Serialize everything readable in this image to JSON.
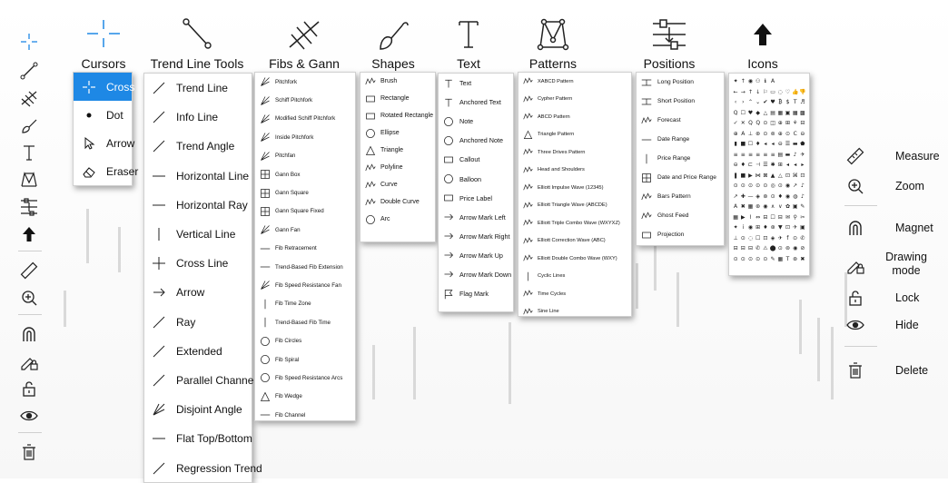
{
  "accent_color": "#1e88e5",
  "headers": {
    "cursors": "Cursors",
    "trend": "Trend Line Tools",
    "fibs": "Fibs & Gann",
    "shapes": "Shapes",
    "text": "Text",
    "patterns": "Patterns",
    "positions": "Positions",
    "icons": "Icons"
  },
  "toolbar": {
    "items": [
      "cursor-cross-icon",
      "trend-line-icon",
      "fib-icon",
      "brush-icon",
      "text-icon",
      "pattern-icon",
      "positions-icon",
      "arrow-up-icon",
      "measure-icon",
      "zoom-icon",
      "magnet-icon",
      "drawing-mode-lock-icon",
      "unlock-icon",
      "eye-icon",
      "trash-icon"
    ]
  },
  "cursors_menu": [
    {
      "label": "Cross",
      "icon": "cross-icon",
      "selected": true
    },
    {
      "label": "Dot",
      "icon": "dot-icon",
      "selected": false
    },
    {
      "label": "Arrow",
      "icon": "arrow-pointer-icon",
      "selected": false
    },
    {
      "label": "Eraser",
      "icon": "eraser-icon",
      "selected": false
    }
  ],
  "trend_menu": [
    {
      "label": "Trend Line",
      "icon": "trend-line-icon"
    },
    {
      "label": "Info Line",
      "icon": "info-line-icon"
    },
    {
      "label": "Trend Angle",
      "icon": "trend-angle-icon"
    },
    {
      "label": "Horizontal Line",
      "icon": "horizontal-line-icon"
    },
    {
      "label": "Horizontal Ray",
      "icon": "horizontal-ray-icon"
    },
    {
      "label": "Vertical Line",
      "icon": "vertical-line-icon"
    },
    {
      "label": "Cross Line",
      "icon": "cross-line-icon"
    },
    {
      "label": "Arrow",
      "icon": "arrow-line-icon"
    },
    {
      "label": "Ray",
      "icon": "ray-icon"
    },
    {
      "label": "Extended",
      "icon": "extended-line-icon"
    },
    {
      "label": "Parallel Channel",
      "icon": "parallel-channel-icon"
    },
    {
      "label": "Disjoint Angle",
      "icon": "disjoint-angle-icon"
    },
    {
      "label": "Flat Top/Bottom",
      "icon": "flat-top-bottom-icon"
    },
    {
      "label": "Regression Trend",
      "icon": "regression-trend-icon"
    }
  ],
  "fibs_menu": [
    {
      "label": "Pitchfork"
    },
    {
      "label": "Schiff Pitchfork"
    },
    {
      "label": "Modified Schiff Pitchfork"
    },
    {
      "label": "Inside Pitchfork"
    },
    {
      "label": "Pitchfan"
    },
    {
      "label": "Gann Box"
    },
    {
      "label": "Gann Square"
    },
    {
      "label": "Gann Square Fixed"
    },
    {
      "label": "Gann Fan"
    },
    {
      "label": "Fib Retracement"
    },
    {
      "label": "Trend-Based Fib Extension"
    },
    {
      "label": "Fib Speed Resistance Fan"
    },
    {
      "label": "Fib Time Zone"
    },
    {
      "label": "Trend-Based Fib Time"
    },
    {
      "label": "Fib Circles"
    },
    {
      "label": "Fib Spiral"
    },
    {
      "label": "Fib Speed Resistance Arcs"
    },
    {
      "label": "Fib Wedge"
    },
    {
      "label": "Fib Channel"
    }
  ],
  "shapes_menu": [
    {
      "label": "Brush"
    },
    {
      "label": "Rectangle"
    },
    {
      "label": "Rotated Rectangle"
    },
    {
      "label": "Ellipse"
    },
    {
      "label": "Triangle"
    },
    {
      "label": "Polyline"
    },
    {
      "label": "Curve"
    },
    {
      "label": "Double Curve"
    },
    {
      "label": "Arc"
    }
  ],
  "text_menu": [
    {
      "label": "Text"
    },
    {
      "label": "Anchored Text"
    },
    {
      "label": "Note"
    },
    {
      "label": "Anchored Note"
    },
    {
      "label": "Callout"
    },
    {
      "label": "Balloon"
    },
    {
      "label": "Price Label"
    },
    {
      "label": "Arrow Mark Left"
    },
    {
      "label": "Arrow Mark Right"
    },
    {
      "label": "Arrow Mark Up"
    },
    {
      "label": "Arrow Mark Down"
    },
    {
      "label": "Flag Mark"
    }
  ],
  "patterns_menu": [
    {
      "label": "XABCD Pattern"
    },
    {
      "label": "Cypher Pattern"
    },
    {
      "label": "ABCD Pattern"
    },
    {
      "label": "Triangle Pattern"
    },
    {
      "label": "Three Drives Pattern"
    },
    {
      "label": "Head and Shoulders"
    },
    {
      "label": "Elliott Impulse Wave (12345)"
    },
    {
      "label": "Elliott Triangle Wave (ABCDE)"
    },
    {
      "label": "Elliott Triple Combo Wave (WXYXZ)"
    },
    {
      "label": "Elliott Correction Wave (ABC)"
    },
    {
      "label": "Elliott Double Combo Wave (WXY)"
    },
    {
      "label": "Cyclic Lines"
    },
    {
      "label": "Time Cycles"
    },
    {
      "label": "Sine Line"
    }
  ],
  "positions_menu": [
    {
      "label": "Long Position"
    },
    {
      "label": "Short Position"
    },
    {
      "label": "Forecast"
    },
    {
      "label": "Date Range"
    },
    {
      "label": "Price Range"
    },
    {
      "label": "Date and Price Range"
    },
    {
      "label": "Bars Pattern"
    },
    {
      "label": "Ghost Feed"
    },
    {
      "label": "Projection"
    }
  ],
  "icons_grid": [
    "✦",
    "↑",
    "◉",
    "⚇",
    "ℹ",
    "A",
    "",
    "",
    "",
    "",
    "←",
    "→",
    "↑",
    "↓",
    "⚐",
    "▭",
    "◌",
    "♡",
    "👍",
    "👎",
    "‹",
    "›",
    "⌃",
    "⌄",
    "✔",
    "♥",
    "₿",
    "$",
    "T",
    "♬",
    "Q",
    "☐",
    "♥",
    "◆",
    "△",
    "▤",
    "▦",
    "▣",
    "▦",
    "▩",
    "✓",
    "✕",
    "Q",
    "Q",
    "⊙",
    "◫",
    "⊕",
    "⊞",
    "⚘",
    "⊟",
    "⊕",
    "A",
    "⊥",
    "⊛",
    "⊙",
    "⊚",
    "⊕",
    "⊙",
    "C",
    "⊖",
    "▮",
    "■",
    "☐",
    "♦",
    "◂",
    "◂",
    "⊖",
    "☰",
    "▬",
    "⬟",
    "≡",
    "≡",
    "≡",
    "≡",
    "≡",
    "≡",
    "▤",
    "▬",
    "♪",
    "✈",
    "⊖",
    "♦",
    "⊏",
    "⊣",
    "☰",
    "✱",
    "⊞",
    "◂",
    "◂",
    "▸",
    "❚",
    "■",
    "▶",
    "⋈",
    "⊠",
    "▲",
    "△",
    "⊡",
    "⌘",
    "⊡",
    "⊙",
    "⊙",
    "⊙",
    "⊙",
    "⊙",
    "◎",
    "⊙",
    "◉",
    "↗",
    "♪",
    "↗",
    "✚",
    "—",
    "◈",
    "⊛",
    "⊙",
    "♦",
    "◉",
    "◍",
    "♪",
    "A",
    "✖",
    "▦",
    "⊛",
    "◉",
    "∧",
    "∨",
    "✿",
    "▣",
    "✎",
    "▦",
    "▶",
    "⌇",
    "⇔",
    "⊟",
    "☐",
    "⊟",
    "✉",
    "⚲",
    "✂",
    "✦",
    "i",
    "◉",
    "⊞",
    "♦",
    "⊛",
    "▼",
    "⊡",
    "✈",
    "▣",
    "⊥",
    "⊙",
    "◌",
    "☐",
    "⊡",
    "◈",
    "✈",
    "f",
    "⊙",
    "✆",
    "⊟",
    "⊟",
    "⊟",
    "✆",
    "⚠",
    "⬤",
    "⊙",
    "⊚",
    "◉",
    "⊘",
    "⊙",
    "⊙",
    "⊙",
    "⊙",
    "⊙",
    "✎",
    "▦",
    "T",
    "⊛",
    "✖"
  ],
  "right_panel": [
    {
      "label": "Measure",
      "icon": "ruler-icon"
    },
    {
      "label": "Zoom",
      "icon": "zoom-in-icon"
    },
    {
      "label": "Magnet",
      "icon": "magnet-icon"
    },
    {
      "label": "Drawing mode",
      "icon": "drawing-mode-icon"
    },
    {
      "label": "Lock",
      "icon": "unlock-icon"
    },
    {
      "label": "Hide",
      "icon": "eye-icon"
    },
    {
      "label": "Delete",
      "icon": "trash-icon"
    }
  ]
}
